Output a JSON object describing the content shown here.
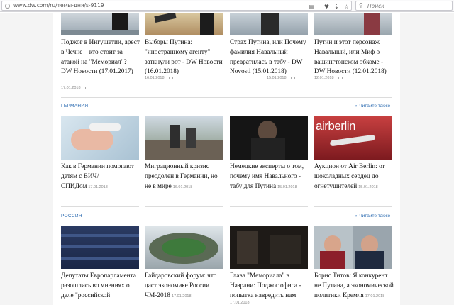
{
  "browser": {
    "url": "www.dw.com/ru/темы-дня/s-9119",
    "search_placeholder": "Поиск"
  },
  "top_row": [
    {
      "title": "Поджог в Ингушетии, арест в Чечне – кто стоит за атакой на \"Мемориал\"? – DW Новости (17.01.2017)",
      "date": "17.01.2018"
    },
    {
      "title": "Выборы Путина: \"иностранному агенту\" заткнули рот - DW Новости (16.01.2018)",
      "date": "16.01.2018"
    },
    {
      "title": "Страх Путина, или Почему фамилия Навальный превратилась в табу - DW Novosti (15.01.2018)",
      "date": "15.01.2018"
    },
    {
      "title": "Путин и этот персонаж Навальный, или Миф о вашингтонском обкоме - DW Новости (12.01.2018)",
      "date": "12.01.2018"
    }
  ],
  "germany": {
    "label": "ГЕРМАНИЯ",
    "read_more": "Читайте также",
    "items": [
      {
        "title": "Как в Германии помогают детям с ВИЧ/СПИДом",
        "date": "17.01.2018"
      },
      {
        "title": "Миграционный кризис преодолен в Германии, но не в мире",
        "date": "16.01.2018"
      },
      {
        "title": "Немецкие эксперты о том, почему имя Навального - табу для Путина",
        "date": "15.01.2018"
      },
      {
        "title": "Аукцион от Air Berlin: от шоколадных сердец до огнетушителей",
        "date": "15.01.2018"
      }
    ]
  },
  "russia": {
    "label": "РОССИЯ",
    "read_more": "Читайте также",
    "items": [
      {
        "title": "Депутаты Европарламента разошлись во мнениях о деле \"российской",
        "date": ""
      },
      {
        "title": "Гайдаровский форум: что даст экономике России ЧМ-2018",
        "date": "17.01.2018"
      },
      {
        "title": "Глава \"Мемориала\" в Назрани: Поджог офиса - попытка навредить нам",
        "date": "17.01.2018"
      },
      {
        "title": "Борис Титов: Я конкурент не Путина, а экономической политики Кремля",
        "date": "17.01.2018"
      }
    ]
  },
  "colors": {
    "accent": "#2a6ab0",
    "text": "#111111",
    "muted": "#888888"
  },
  "icons": [
    "lock-icon",
    "reader-icon",
    "pocket-icon",
    "download-icon",
    "star-icon",
    "search-icon",
    "chevron-right-icon",
    "video-icon"
  ]
}
